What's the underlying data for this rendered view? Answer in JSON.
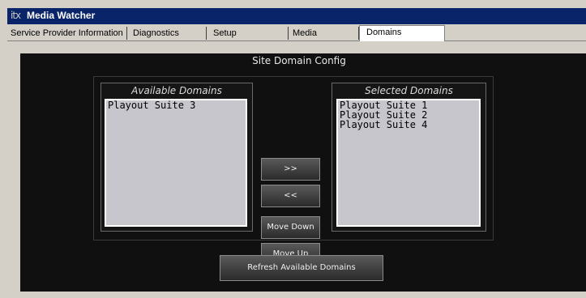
{
  "window": {
    "logo": "itx",
    "title": "Media Watcher"
  },
  "tabs": [
    {
      "label": "Service Provider Information"
    },
    {
      "label": "Diagnostics"
    },
    {
      "label": "Setup"
    },
    {
      "label": "Media"
    },
    {
      "label": "Domains"
    }
  ],
  "active_tab": "Domains",
  "panel": {
    "title": "Site Domain Config",
    "available": {
      "title": "Available Domains",
      "items": [
        "Playout Suite 3"
      ]
    },
    "selected": {
      "title": "Selected Domains",
      "items": [
        "Playout Suite 1",
        "Playout Suite 2",
        "Playout Suite 4"
      ]
    },
    "buttons": {
      "add": ">>",
      "remove": "<<",
      "move_down": "Move Down",
      "move_up": "Move Up",
      "refresh": "Refresh Available Domains"
    }
  }
}
